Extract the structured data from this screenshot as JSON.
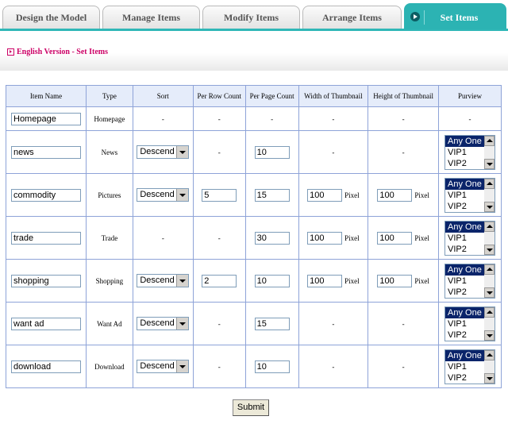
{
  "tabs": [
    {
      "label": "Design the Model",
      "active": false
    },
    {
      "label": "Manage Items",
      "active": false
    },
    {
      "label": "Modify Items",
      "active": false
    },
    {
      "label": "Arrange Items",
      "active": false
    },
    {
      "label": "Set Items",
      "active": true
    }
  ],
  "breadcrumb": "English Version - Set Items",
  "table": {
    "headers": [
      "Item Name",
      "Type",
      "Sort",
      "Per Row Count",
      "Per Page Count",
      "Width of Thumbnail",
      "Height of Thumbnail",
      "Purview"
    ],
    "dash": "-",
    "pixel_label": "Pixel",
    "purview_options": [
      "Any One",
      "VIP1",
      "VIP2"
    ],
    "rows": [
      {
        "name": "Homepage",
        "type": "Homepage"
      },
      {
        "name": "news",
        "type": "News",
        "sort": "Descend",
        "page_count": "10"
      },
      {
        "name": "commodity",
        "type": "Pictures",
        "sort": "Descend",
        "row_count": "5",
        "page_count": "15",
        "width": "100",
        "height": "100"
      },
      {
        "name": "trade",
        "type": "Trade",
        "page_count": "30",
        "width": "100",
        "height": "100"
      },
      {
        "name": "shopping",
        "type": "Shopping",
        "sort": "Descend",
        "row_count": "2",
        "page_count": "10",
        "width": "100",
        "height": "100"
      },
      {
        "name": "want ad",
        "type": "Want Ad",
        "sort": "Descend",
        "page_count": "15"
      },
      {
        "name": "download",
        "type": "Download",
        "sort": "Descend",
        "page_count": "10"
      }
    ]
  },
  "submit_label": "Submit",
  "colors": {
    "accent": "#2cb3b3",
    "breadcrumb": "#cc0066",
    "header_bg": "#e5ecfa",
    "border": "#8ea3d8"
  }
}
